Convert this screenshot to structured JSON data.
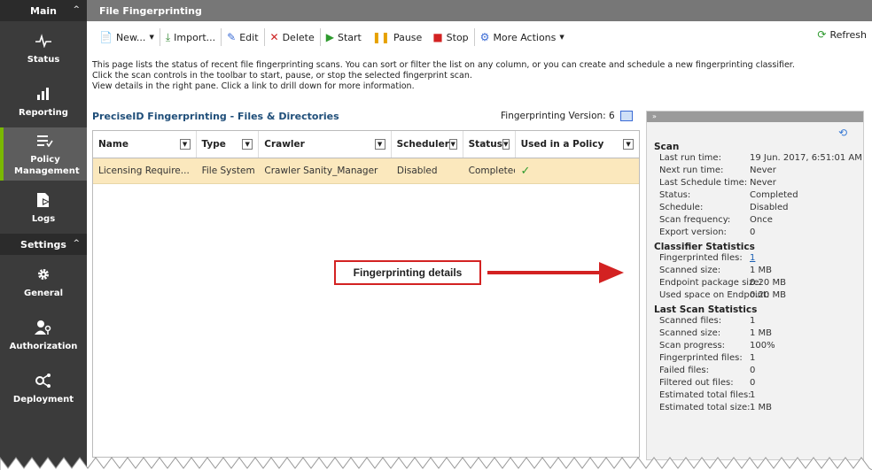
{
  "sidebar": {
    "main_label": "Main",
    "items": [
      {
        "label": "Status"
      },
      {
        "label": "Reporting"
      },
      {
        "label": "Policy Management"
      },
      {
        "label": "Logs"
      }
    ],
    "settings_label": "Settings",
    "settings_items": [
      {
        "label": "General"
      },
      {
        "label": "Authorization"
      },
      {
        "label": "Deployment"
      }
    ]
  },
  "page_title": "File Fingerprinting",
  "toolbar": {
    "new": "New...",
    "import": "Import...",
    "edit": "Edit",
    "delete": "Delete",
    "start": "Start",
    "pause": "Pause",
    "stop": "Stop",
    "more": "More Actions",
    "refresh": "Refresh"
  },
  "description": {
    "line1": "This page lists the status of recent file fingerprinting scans. You can sort or filter the list on any column, or you can create and schedule a new fingerprinting classifier.",
    "line2": "Click the scan controls in the toolbar to start, pause, or stop the selected fingerprint scan.",
    "line3": "View details in the right pane. Click a link to drill down for more information."
  },
  "section_title": "PreciseID Fingerprinting - Files & Directories",
  "fingerprinting_version": "Fingerprinting Version: 6",
  "table": {
    "headers": [
      "Name",
      "Type",
      "Crawler",
      "Scheduler",
      "Status",
      "Used in a Policy"
    ],
    "row": {
      "name": "Licensing Require...",
      "type": "File System",
      "crawler": "Crawler Sanity_Manager",
      "scheduler": "Disabled",
      "status": "Completed",
      "used": "✓"
    }
  },
  "annotation": "Fingerprinting details",
  "pane": {
    "collapse": "»",
    "scan_title": "Scan",
    "scan": [
      {
        "k": "Last run time:",
        "v": "19 Jun. 2017, 6:51:01 AM"
      },
      {
        "k": "Next run time:",
        "v": "Never"
      },
      {
        "k": "Last Schedule time:",
        "v": "Never"
      },
      {
        "k": "Status:",
        "v": "Completed"
      },
      {
        "k": "Schedule:",
        "v": "Disabled"
      },
      {
        "k": "Scan frequency:",
        "v": "Once"
      },
      {
        "k": "Export version:",
        "v": "0"
      }
    ],
    "classifier_title": "Classifier Statistics",
    "classifier": [
      {
        "k": "Fingerprinted files:",
        "v": "1"
      },
      {
        "k": "Scanned size:",
        "v": "1 MB"
      },
      {
        "k": "Endpoint package size:",
        "v": "0.20 MB"
      },
      {
        "k": "Used space on Endpoint:",
        "v": "0.20 MB"
      }
    ],
    "last_title": "Last Scan Statistics",
    "last": [
      {
        "k": "Scanned files:",
        "v": "1"
      },
      {
        "k": "Scanned size:",
        "v": "1 MB"
      },
      {
        "k": "Scan progress:",
        "v": "100%"
      },
      {
        "k": "Fingerprinted files:",
        "v": "1"
      },
      {
        "k": "Failed files:",
        "v": "0"
      },
      {
        "k": "Filtered out files:",
        "v": "0"
      },
      {
        "k": "Estimated total files:",
        "v": "1"
      },
      {
        "k": "Estimated total size:",
        "v": "1 MB"
      }
    ]
  },
  "colors": {
    "sidebar_bg": "#3b3b3b",
    "active_accent": "#7ab800",
    "selected_row": "#fbe8bd",
    "callout_red": "#d32222"
  }
}
